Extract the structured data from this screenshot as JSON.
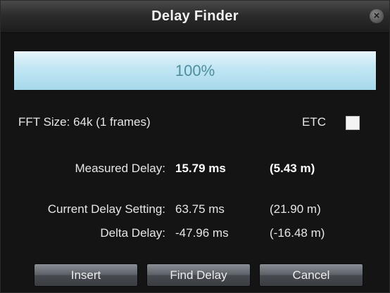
{
  "window": {
    "title": "Delay Finder"
  },
  "progress": {
    "label": "100%",
    "value": 1.0
  },
  "fft": {
    "label": "FFT Size: 64k (1 frames)"
  },
  "etc": {
    "label": "ETC",
    "checked": false
  },
  "measured": {
    "label": "Measured Delay:",
    "ms": "15.79 ms",
    "m": "(5.43 m)"
  },
  "current": {
    "label": "Current Delay Setting:",
    "ms": "63.75 ms",
    "m": "(21.90 m)"
  },
  "delta": {
    "label": "Delta Delay:",
    "ms": "-47.96 ms",
    "m": "(-16.48 m)"
  },
  "buttons": {
    "insert": "Insert",
    "find_delay": "Find Delay",
    "cancel": "Cancel"
  },
  "icons": {
    "close": "close-icon"
  }
}
